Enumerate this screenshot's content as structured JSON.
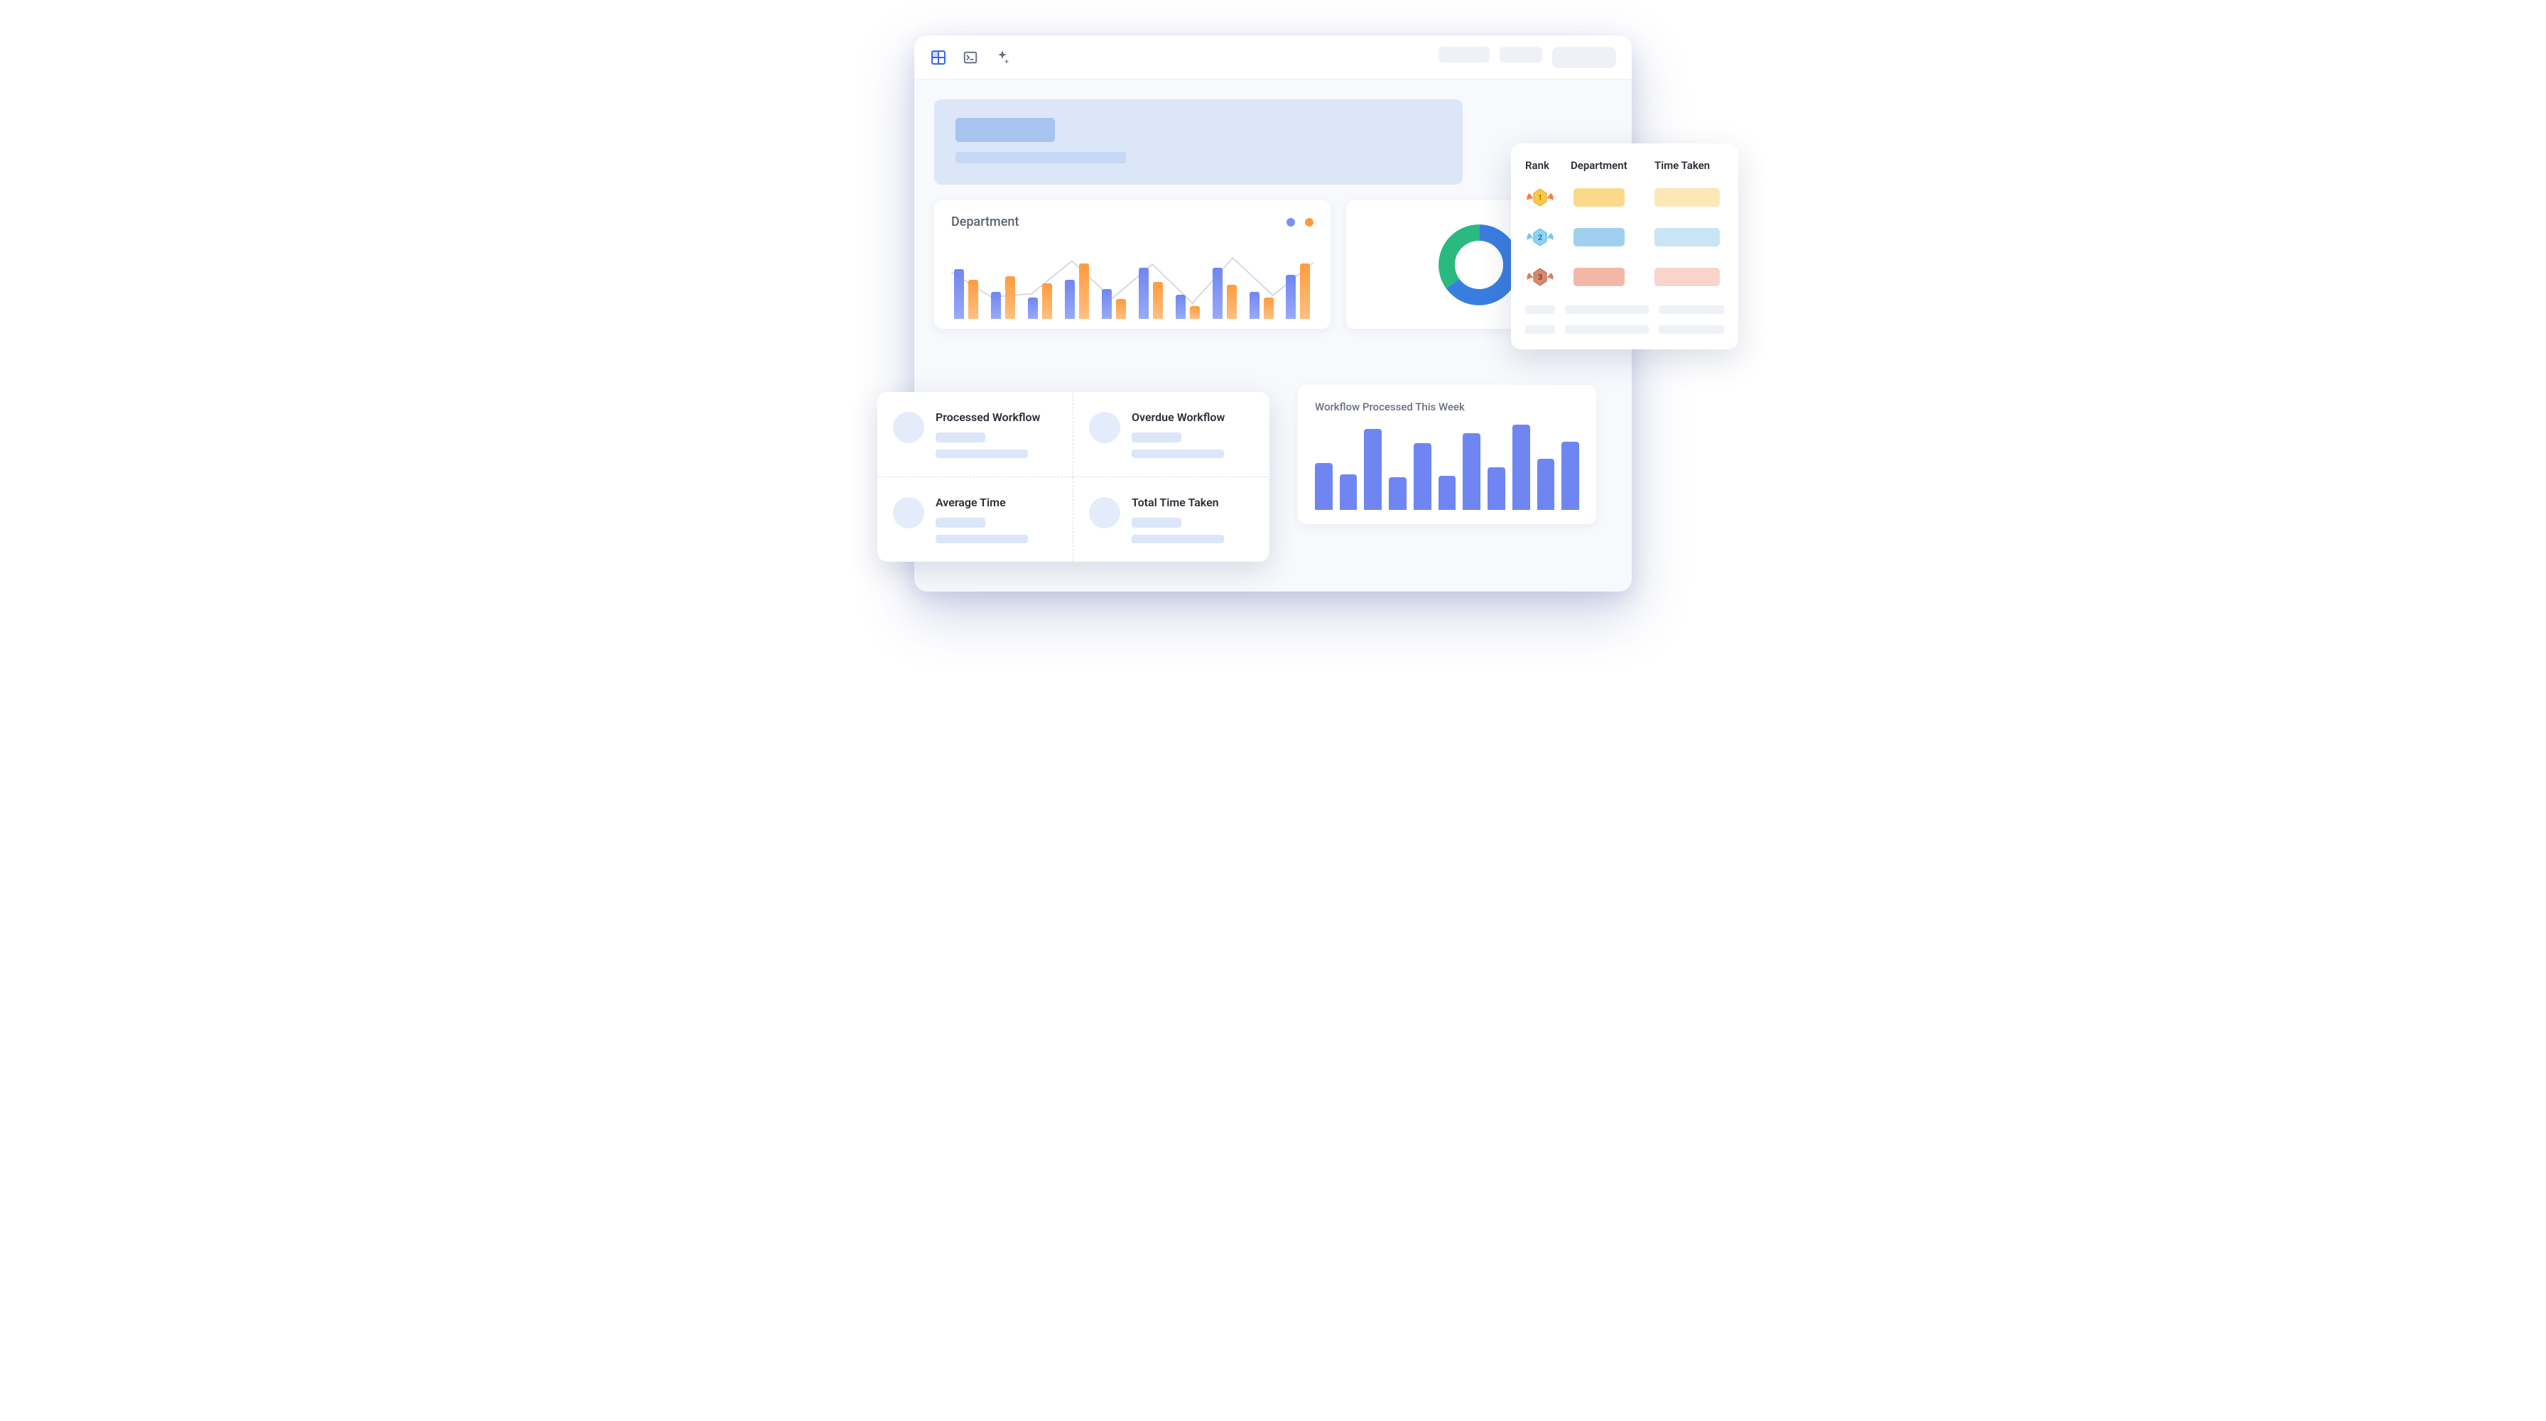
{
  "toolbar": {
    "icons": [
      "dashboard-icon",
      "terminal-icon",
      "sparkle-icon"
    ]
  },
  "department": {
    "title": "Department",
    "legend": [
      "series-a",
      "series-b"
    ]
  },
  "metrics": [
    {
      "label": "Processed Workflow"
    },
    {
      "label": "Overdue Workflow"
    },
    {
      "label": "Average Time"
    },
    {
      "label": "Total Time Taken"
    }
  ],
  "workflow_week": {
    "title": "Workflow Processed This Week"
  },
  "rank": {
    "headers": {
      "rank": "Rank",
      "dept": "Department",
      "time": "Time Taken"
    },
    "rows": [
      {
        "rank": 1,
        "tier": "gold"
      },
      {
        "rank": 2,
        "tier": "silver"
      },
      {
        "rank": 3,
        "tier": "bronze"
      }
    ]
  },
  "chart_data": [
    {
      "type": "bar",
      "title": "Department",
      "series": [
        {
          "name": "series-a",
          "color": "#7d8ff0",
          "values": [
            70,
            38,
            30,
            55,
            42,
            72,
            34,
            72,
            38,
            62
          ]
        },
        {
          "name": "series-b",
          "color": "#ff9b3d",
          "values": [
            55,
            60,
            50,
            78,
            28,
            52,
            18,
            48,
            30,
            78
          ]
        }
      ],
      "trendline": [
        60,
        28,
        32,
        74,
        26,
        70,
        20,
        78,
        30,
        72
      ]
    },
    {
      "type": "pie",
      "title": "Donut",
      "series": [
        {
          "name": "a",
          "color": "#2aba80",
          "value": 35
        },
        {
          "name": "b",
          "color": "#3a7de0",
          "value": 65
        }
      ]
    },
    {
      "type": "bar",
      "title": "Workflow Processed This Week",
      "values": [
        55,
        42,
        95,
        38,
        78,
        40,
        90,
        50,
        100,
        60,
        80
      ]
    }
  ]
}
